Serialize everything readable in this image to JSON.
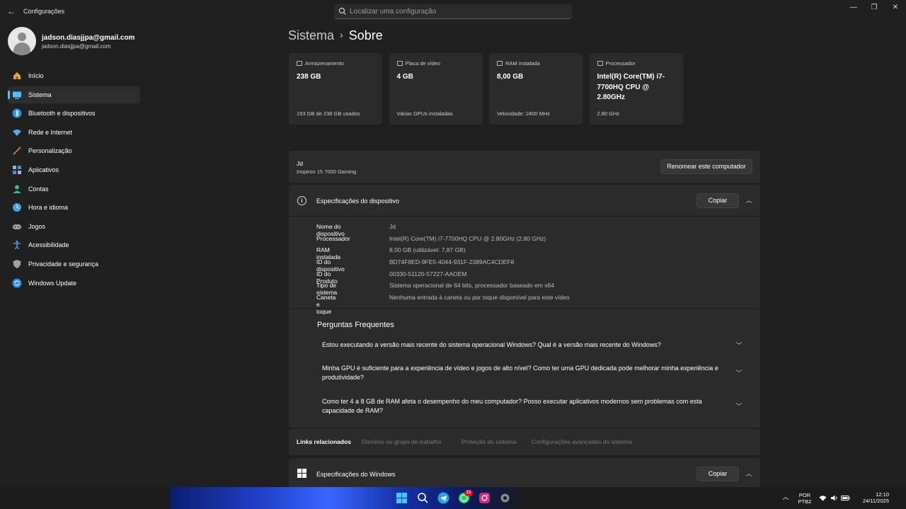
{
  "app": {
    "title": "Configurações",
    "back_glyph": "←"
  },
  "search": {
    "placeholder": "Localizar uma configuração"
  },
  "window_controls": {
    "minimize": "—",
    "maximize": "❐",
    "close": "✕"
  },
  "user": {
    "name": "jadson.diasjjpa@gmail.com",
    "email": "jadson.diasjjpa@gmail.com"
  },
  "sidebar": {
    "items": [
      {
        "label": "Início",
        "icon": "home-icon",
        "color": "#e8a33a"
      },
      {
        "label": "Sistema",
        "icon": "system-icon",
        "color": "#4cc2ff",
        "active": true
      },
      {
        "label": "Bluetooth e dispositivos",
        "icon": "bluetooth-icon",
        "color": "#2b8de0"
      },
      {
        "label": "Rede e Internet",
        "icon": "wifi-icon",
        "color": "#5aa9f0"
      },
      {
        "label": "Personalização",
        "icon": "brush-icon",
        "color": "#e8944a"
      },
      {
        "label": "Aplicativos",
        "icon": "apps-icon",
        "color": "#8fb4d8"
      },
      {
        "label": "Contas",
        "icon": "accounts-icon",
        "color": "#2ec27e"
      },
      {
        "label": "Hora e idioma",
        "icon": "clock-globe-icon",
        "color": "#4aa3df"
      },
      {
        "label": "Jogos",
        "icon": "gamepad-icon",
        "color": "#9aa0a6"
      },
      {
        "label": "Acessibilidade",
        "icon": "accessibility-icon",
        "color": "#3b9de8"
      },
      {
        "label": "Privacidade e segurança",
        "icon": "shield-icon",
        "color": "#9aa0a6"
      },
      {
        "label": "Windows Update",
        "icon": "update-icon",
        "color": "#2b8de0"
      }
    ]
  },
  "breadcrumb": {
    "parent": "Sistema",
    "separator": "›",
    "current": "Sobre"
  },
  "cards": [
    {
      "head": "Armazenamento",
      "icon": "storage-icon",
      "value": "238 GB",
      "foot": "193 GB de 238 GB usados"
    },
    {
      "head": "Placa de vídeo",
      "icon": "gpu-icon",
      "value": "4 GB",
      "foot": "Várias GPUs instaladas"
    },
    {
      "head": "RAM instalada",
      "icon": "ram-icon",
      "value": "8,00 GB",
      "foot": "Velocidade: 2400 MHz"
    },
    {
      "head": "Processador",
      "icon": "cpu-icon",
      "value": "Intel(R) Core(TM) i7-7700HQ CPU @ 2.80GHz",
      "foot": "2.80 GHz"
    }
  ],
  "computer": {
    "name": "Jd",
    "model": "Inspiron 15 7000 Gaming",
    "rename_label": "Renomear este computador"
  },
  "device_specs": {
    "title": "Especificações do dispositivo",
    "copy_label": "Copiar",
    "info_glyph": "i",
    "chevron": "︿",
    "rows": [
      {
        "label": "Nome do dispositivo",
        "value": "Jd"
      },
      {
        "label": "Processador",
        "value": "Intel(R) Core(TM) i7-7700HQ CPU @ 2.80GHz (2.80 GHz)"
      },
      {
        "label": "RAM instalada",
        "value": "8,00 GB (utilizável: 7,87 GB)"
      },
      {
        "label": "ID do dispositivo",
        "value": "BD74F8ED-9FE5-4044-931F-2389AC4CDEF8"
      },
      {
        "label": "ID do Produto",
        "value": "00330-51120-57227-AAOEM"
      },
      {
        "label": "Tipo de sistema",
        "value": "Sistema operacional de 64 bits, processador baseado em x64"
      },
      {
        "label": "Caneta e toque",
        "value": "Nenhuma entrada à caneta ou por toque disponível para este vídeo"
      }
    ]
  },
  "faq": {
    "title": "Perguntas Frequentes",
    "chevron": "﹀",
    "items": [
      {
        "text": "Estou executando a versão mais recente do sistema operacional Windows? Qual é a versão mais recente do Windows?"
      },
      {
        "text": "Minha GPU é suficiente para a experiência de vídeo e jogos de alto nível? Como ter uma GPU dedicada pode melhorar minha experiência e produtividade?"
      },
      {
        "text": "Como ter 4 a 8 GB de RAM afeta o desempenho do meu computador? Posso executar aplicativos modernos sem problemas com esta capacidade de RAM?"
      }
    ]
  },
  "related_links": {
    "label": "Links relacionados",
    "links": [
      "Domínio ou grupo de trabalho",
      "Proteção do sistema",
      "Configurações avançadas do sistema"
    ]
  },
  "windows_specs": {
    "title": "Especificações do Windows",
    "copy_label": "Copiar",
    "chevron": "︿"
  },
  "taskbar": {
    "language_top": "POR",
    "language_bottom": "PTB2",
    "time": "12:10",
    "date": "24/11/2025",
    "tray_chevron": "︿",
    "whatsapp_badge": "15"
  }
}
